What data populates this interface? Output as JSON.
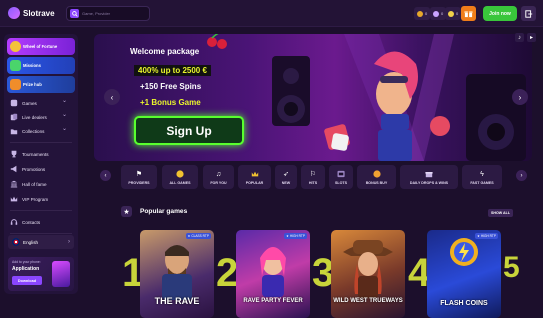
{
  "header": {
    "brand": "Slotrave",
    "search_placeholder": "Game, Provider",
    "wallet": [
      {
        "count": "0"
      },
      {
        "count": "0"
      },
      {
        "count": "0"
      }
    ],
    "join_label": "Join now"
  },
  "sidebar": {
    "promos": [
      "Wheel of Fortune",
      "Missions",
      "Prize hub"
    ],
    "nav": [
      "Games",
      "Live dealers",
      "Collections",
      "Tournaments",
      "Promotions",
      "Hall of fame",
      "VIP Program",
      "Contacts"
    ],
    "language": "English",
    "app": {
      "line1": "Add to your phone:",
      "line2": "Application",
      "button": "Download"
    }
  },
  "banner": {
    "headline": "Welcome package",
    "offer1": "400% up to 2500 €",
    "offer2": "+150 Free Spins",
    "offer3": "+1 Bonus Game",
    "cta": "Sign Up"
  },
  "categories": [
    {
      "label": "PROVIDERS",
      "icon": "flag-icon"
    },
    {
      "label": "ALL GAMES",
      "icon": "smiley-icon"
    },
    {
      "label": "FOR YOU",
      "icon": "music-icon"
    },
    {
      "label": "POPULAR",
      "icon": "crown-icon"
    },
    {
      "label": "NEW",
      "icon": "rocket-icon"
    },
    {
      "label": "HITS",
      "icon": "flag2-icon"
    },
    {
      "label": "SLOTS",
      "icon": "slot-icon"
    },
    {
      "label": "BONUS BUY",
      "icon": "coin-icon"
    },
    {
      "label": "DAILY DROPS & WINS",
      "icon": "gift-icon"
    },
    {
      "label": "FAST GAMES",
      "icon": "bolt-icon"
    }
  ],
  "popular": {
    "title": "Popular games",
    "show_all": "SHOW ALL",
    "games": [
      {
        "rank": "1",
        "title": "THE RAVE",
        "tag": "★ CLASS RTP"
      },
      {
        "rank": "2",
        "title": "RAVE PARTY FEVER",
        "tag": "★ HIGH RTP"
      },
      {
        "rank": "3",
        "title": "WILD WEST TRUEWAYS",
        "tag": ""
      },
      {
        "rank": "4",
        "title": "FLASH COINS",
        "tag": "★ HIGH RTP"
      }
    ],
    "next_rank": "5"
  },
  "colors": {
    "accent": "#8a46ff",
    "join": "#39c63b",
    "cta_glow": "#58ff2e",
    "rank": "#c8d43a"
  }
}
